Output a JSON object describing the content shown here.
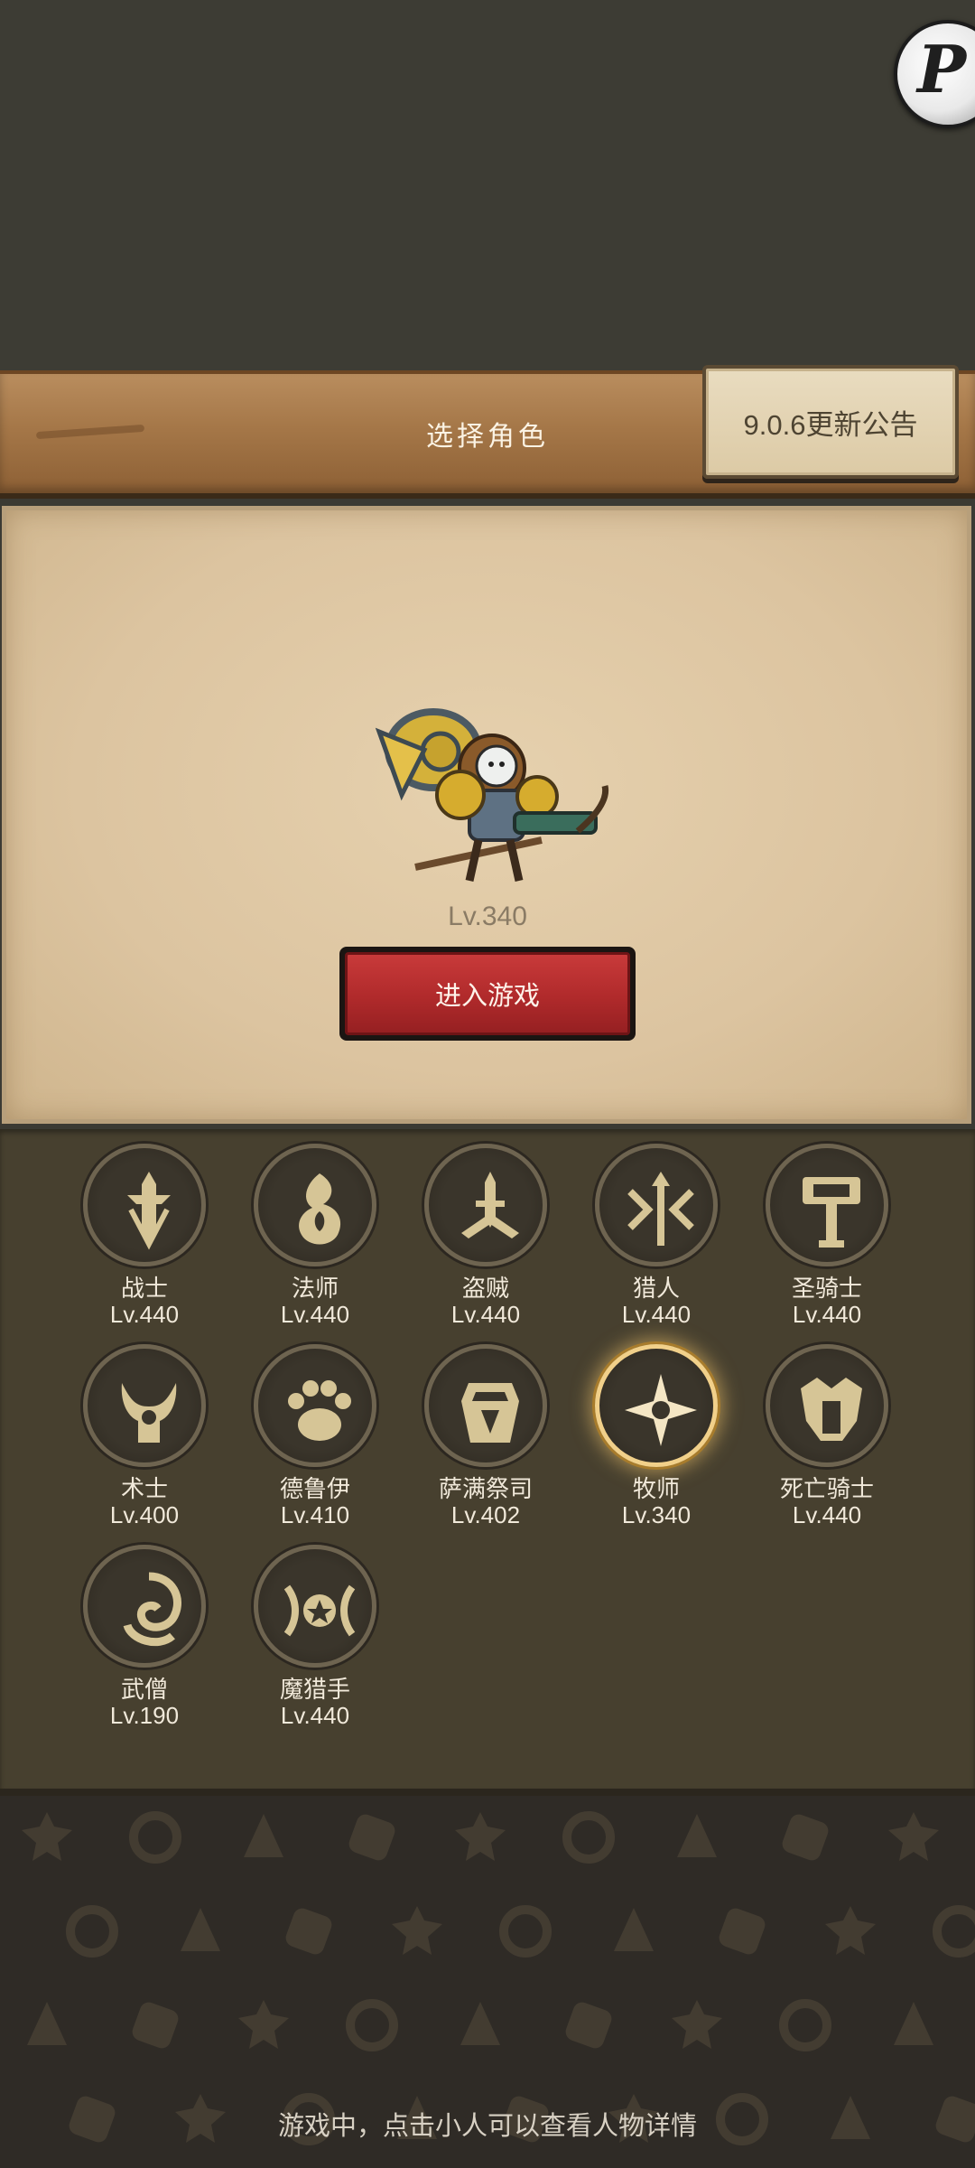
{
  "header": {
    "title": "选择角色",
    "notice_label": "9.0.6更新公告",
    "corner_badge_glyph": "P"
  },
  "selected_character": {
    "level": "Lv.340",
    "enter_label": "进入游戏"
  },
  "classes": [
    {
      "name": "战士",
      "level": "Lv.440",
      "icon": "sword-icon"
    },
    {
      "name": "法师",
      "level": "Lv.440",
      "icon": "flame-icon"
    },
    {
      "name": "盗贼",
      "level": "Lv.440",
      "icon": "daggers-icon"
    },
    {
      "name": "猎人",
      "level": "Lv.440",
      "icon": "arrows-icon"
    },
    {
      "name": "圣骑士",
      "level": "Lv.440",
      "icon": "hammer-icon"
    },
    {
      "name": "术士",
      "level": "Lv.400",
      "icon": "demon-icon"
    },
    {
      "name": "德鲁伊",
      "level": "Lv.410",
      "icon": "paw-icon"
    },
    {
      "name": "萨满祭司",
      "level": "Lv.402",
      "icon": "totem-icon"
    },
    {
      "name": "牧师",
      "level": "Lv.340",
      "icon": "star-burst-icon",
      "selected": true
    },
    {
      "name": "死亡骑士",
      "level": "Lv.440",
      "icon": "helm-icon"
    },
    {
      "name": "武僧",
      "level": "Lv.190",
      "icon": "swirl-icon"
    },
    {
      "name": "魔猎手",
      "level": "Lv.440",
      "icon": "wings-star-icon"
    }
  ],
  "footer": {
    "hint": "游戏中，点击小人可以查看人物详情"
  },
  "colors": {
    "accent_gold": "#f1d08a",
    "button_red": "#b02a2b",
    "panel_brown": "#47402f"
  }
}
